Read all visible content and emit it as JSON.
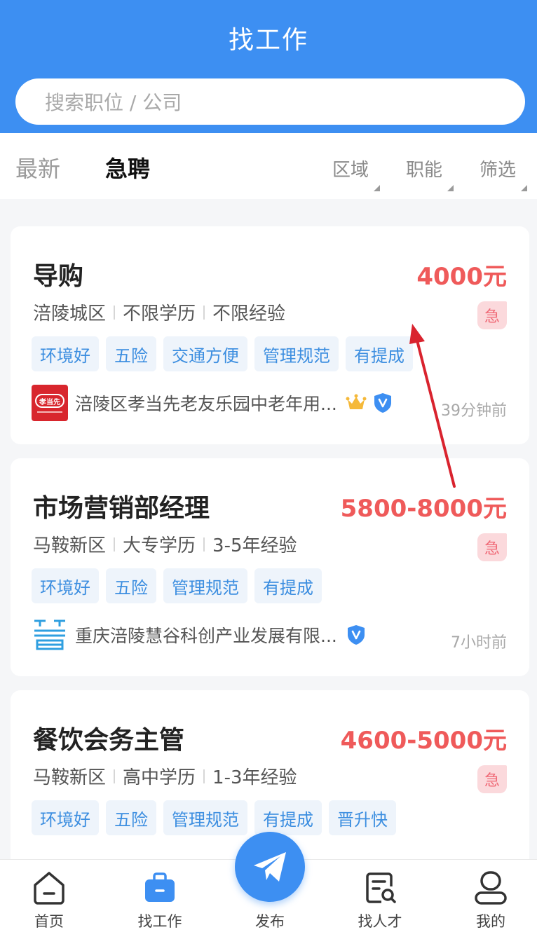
{
  "header": {
    "title": "找工作"
  },
  "search": {
    "placeholder": "搜索职位 / 公司"
  },
  "tabs": [
    {
      "label": "最新"
    },
    {
      "label": "急聘"
    }
  ],
  "filters": [
    {
      "label": "区域"
    },
    {
      "label": "职能"
    },
    {
      "label": "筛选"
    }
  ],
  "jobs": [
    {
      "title": "导购",
      "salary": "4000元",
      "district": "涪陵城区",
      "education": "不限学历",
      "experience": "不限经验",
      "urgent_label": "急",
      "tags": [
        "环境好",
        "五险",
        "交通方便",
        "管理规范",
        "有提成"
      ],
      "logo_text": "孝当先",
      "company": "涪陵区孝当先老友乐园中老年用...",
      "time": "39分钟前"
    },
    {
      "title": "市场营销部经理",
      "salary": "5800-8000元",
      "district": "马鞍新区",
      "education": "大专学历",
      "experience": "3-5年经验",
      "urgent_label": "急",
      "tags": [
        "环境好",
        "五险",
        "管理规范",
        "有提成"
      ],
      "company": "重庆涪陵慧谷科创产业发展有限...",
      "time": "7小时前"
    },
    {
      "title": "餐饮会务主管",
      "salary": "4600-5000元",
      "district": "马鞍新区",
      "education": "高中学历",
      "experience": "1-3年经验",
      "urgent_label": "急",
      "tags": [
        "环境好",
        "五险",
        "管理规范",
        "有提成",
        "晋升快"
      ]
    }
  ],
  "nav": [
    {
      "label": "首页",
      "icon": "home-icon"
    },
    {
      "label": "找工作",
      "icon": "briefcase-icon"
    },
    {
      "label": "发布",
      "icon": "paper-plane-icon"
    },
    {
      "label": "找人才",
      "icon": "talent-search-icon"
    },
    {
      "label": "我的",
      "icon": "profile-icon"
    }
  ],
  "colors": {
    "primary": "#3d8ff2",
    "salary": "#ef5a5a",
    "tag_text": "#3c8ee0",
    "tag_bg": "#eef4fb",
    "annotation_arrow": "#d9232e"
  }
}
